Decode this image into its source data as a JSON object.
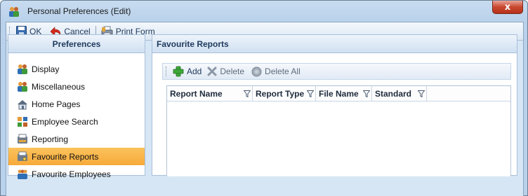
{
  "window": {
    "title": "Personal Preferences (Edit)",
    "close_glyph": "x"
  },
  "toolbar": {
    "ok_label": "OK",
    "cancel_label": "Cancel",
    "print_label": "Print Form"
  },
  "left_panel": {
    "header": "Preferences",
    "items": [
      {
        "label": "Display",
        "icon": "users-icon"
      },
      {
        "label": "Miscellaneous",
        "icon": "users-icon"
      },
      {
        "label": "Home Pages",
        "icon": "home-icon"
      },
      {
        "label": "Employee Search",
        "icon": "employee-search-icon"
      },
      {
        "label": "Reporting",
        "icon": "report-icon"
      },
      {
        "label": "Favourite Reports",
        "icon": "favourite-report-icon",
        "selected": true
      },
      {
        "label": "Favourite Employees",
        "icon": "favourite-employees-icon"
      }
    ]
  },
  "right_panel": {
    "header": "Favourite Reports",
    "sub_toolbar": {
      "add_label": "Add",
      "delete_label": "Delete",
      "delete_all_label": "Delete All"
    },
    "grid": {
      "columns": [
        "Report Name",
        "Report Type",
        "File Name",
        "Standard"
      ],
      "rows": []
    }
  },
  "colors": {
    "selected_item": "#f7a93a",
    "close_button": "#c8482f",
    "header_text": "#1e395b"
  }
}
